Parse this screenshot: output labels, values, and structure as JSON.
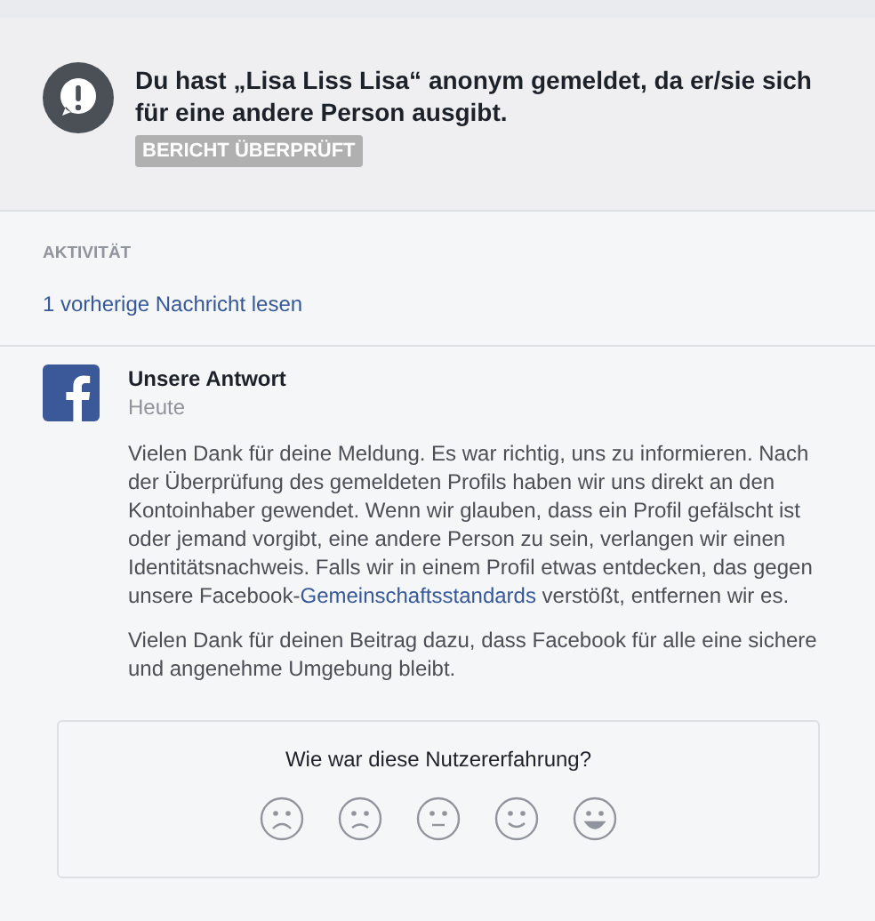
{
  "report": {
    "message": "Du hast „Lisa Liss Lisa“ anonym gemeldet, da er/sie sich für eine andere Person ausgibt.",
    "status_badge": "BERICHT ÜBERPRÜFT"
  },
  "activity": {
    "heading": "AKTIVITÄT",
    "previous_link": "1 vorherige Nachricht lesen"
  },
  "reply": {
    "author": "Unsere Antwort",
    "time": "Heute",
    "paragraphs": [
      {
        "before": "Vielen Dank für deine Meldung. Es war richtig, uns zu informieren. Nach der Überprüfung des gemeldeten Profils haben wir uns direkt an den Kontoinhaber gewendet. Wenn wir glauben, dass ein Profil gefälscht ist oder jemand vorgibt, eine andere Person zu sein, verlangen wir einen Identitätsnachweis. Falls wir in einem Profil etwas entdecken, das gegen unsere Facebook-",
        "link": "Gemeinschaftsstandards",
        "after": " verstößt, entfernen wir es."
      },
      {
        "before": "Vielen Dank für deinen Beitrag dazu, dass Facebook für alle eine sichere und angenehme Umgebung bleibt."
      }
    ]
  },
  "rating": {
    "question": "Wie war diese Nutzererfahrung?",
    "faces": [
      {
        "kind": "very_sad"
      },
      {
        "kind": "sad"
      },
      {
        "kind": "neutral"
      },
      {
        "kind": "happy"
      },
      {
        "kind": "very_happy"
      }
    ]
  }
}
